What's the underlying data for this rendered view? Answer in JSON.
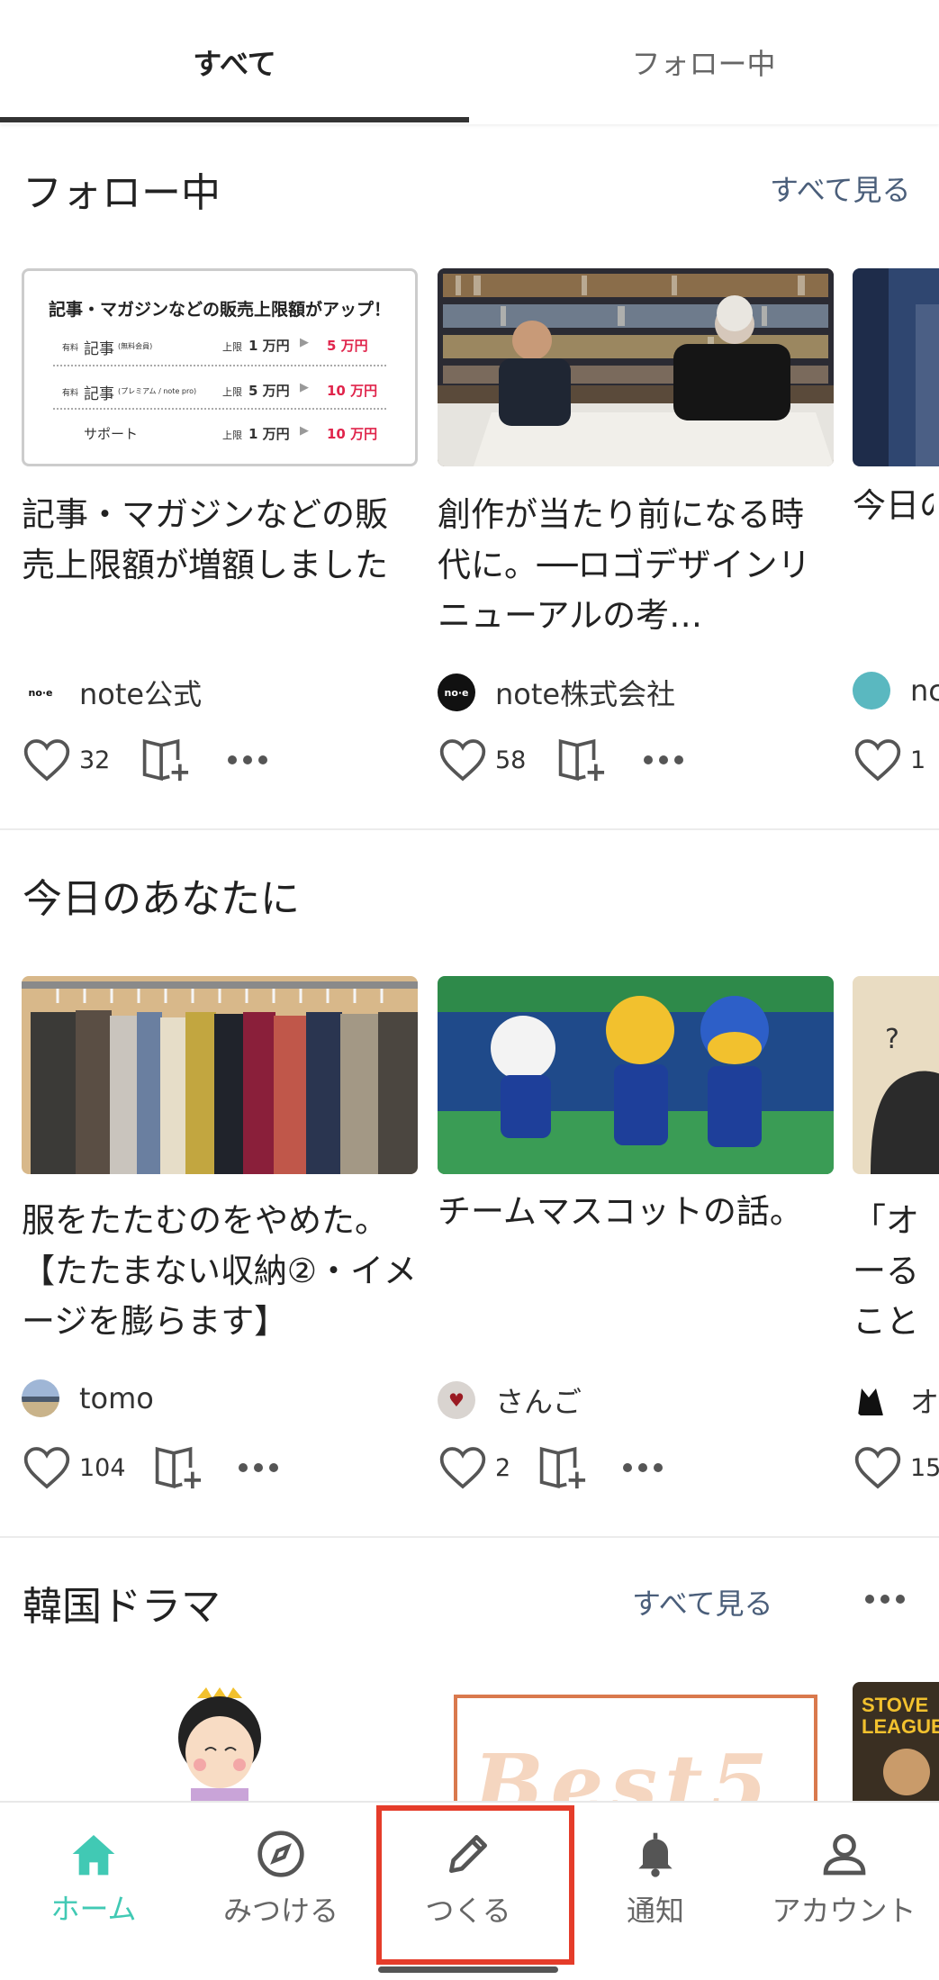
{
  "tabs": [
    {
      "label": "すべて",
      "active": true
    },
    {
      "label": "フォロー中",
      "active": false
    }
  ],
  "sections": {
    "following": {
      "title": "フォロー中",
      "see_all": "すべて見る",
      "cards": [
        {
          "title": "記事・マガジンなどの販売上限額が増額しました",
          "author": "note公式",
          "likes": "32",
          "promo": {
            "heading": "記事・マガジンなどの販売上限額がアップ！",
            "rows": [
              {
                "prefix": "有料",
                "item": "記事",
                "note": "(無料会員)",
                "limit_label": "上限",
                "from": "1 万円",
                "to": "5 万円"
              },
              {
                "prefix": "有料",
                "item": "記事",
                "note": "(プレミアム / note pro)",
                "limit_label": "上限",
                "from": "5 万円",
                "to": "10 万円"
              },
              {
                "prefix": "",
                "item": "サポート",
                "note": "",
                "limit_label": "上限",
                "from": "1 万円",
                "to": "10 万円"
              }
            ]
          }
        },
        {
          "title": "創作が当たり前になる時代に。──ロゴデザインリニューアルの考…",
          "author": "note株式会社",
          "likes": "58"
        },
        {
          "title": "今日の",
          "author": "nc",
          "likes": "1"
        }
      ]
    },
    "today": {
      "title": "今日のあなたに",
      "cards": [
        {
          "title": "服をたたむのをやめた。【たたまない収納②・イメージを膨らます】",
          "author": "tomo",
          "likes": "104"
        },
        {
          "title": "チームマスコットの話。",
          "author": "さんご",
          "likes": "2"
        },
        {
          "title": "「オーることーロン",
          "author": "オ",
          "likes": "15"
        }
      ]
    },
    "kdrama": {
      "title": "韓国ドラマ",
      "see_all": "すべて見る",
      "image_text": "Best5",
      "peek_text": "STOVE LEAGUE"
    }
  },
  "bottom_nav": [
    {
      "label": "ホーム",
      "icon": "home-icon",
      "active": true
    },
    {
      "label": "みつける",
      "icon": "compass-icon",
      "active": false
    },
    {
      "label": "つくる",
      "icon": "pencil-icon",
      "active": false
    },
    {
      "label": "通知",
      "icon": "bell-icon",
      "active": false
    },
    {
      "label": "アカウント",
      "icon": "person-icon",
      "active": false
    }
  ],
  "colors": {
    "accent": "#41c9b4",
    "link": "#4a5e7a",
    "highlight": "#e53c2a",
    "promo_red": "#e0244b"
  }
}
